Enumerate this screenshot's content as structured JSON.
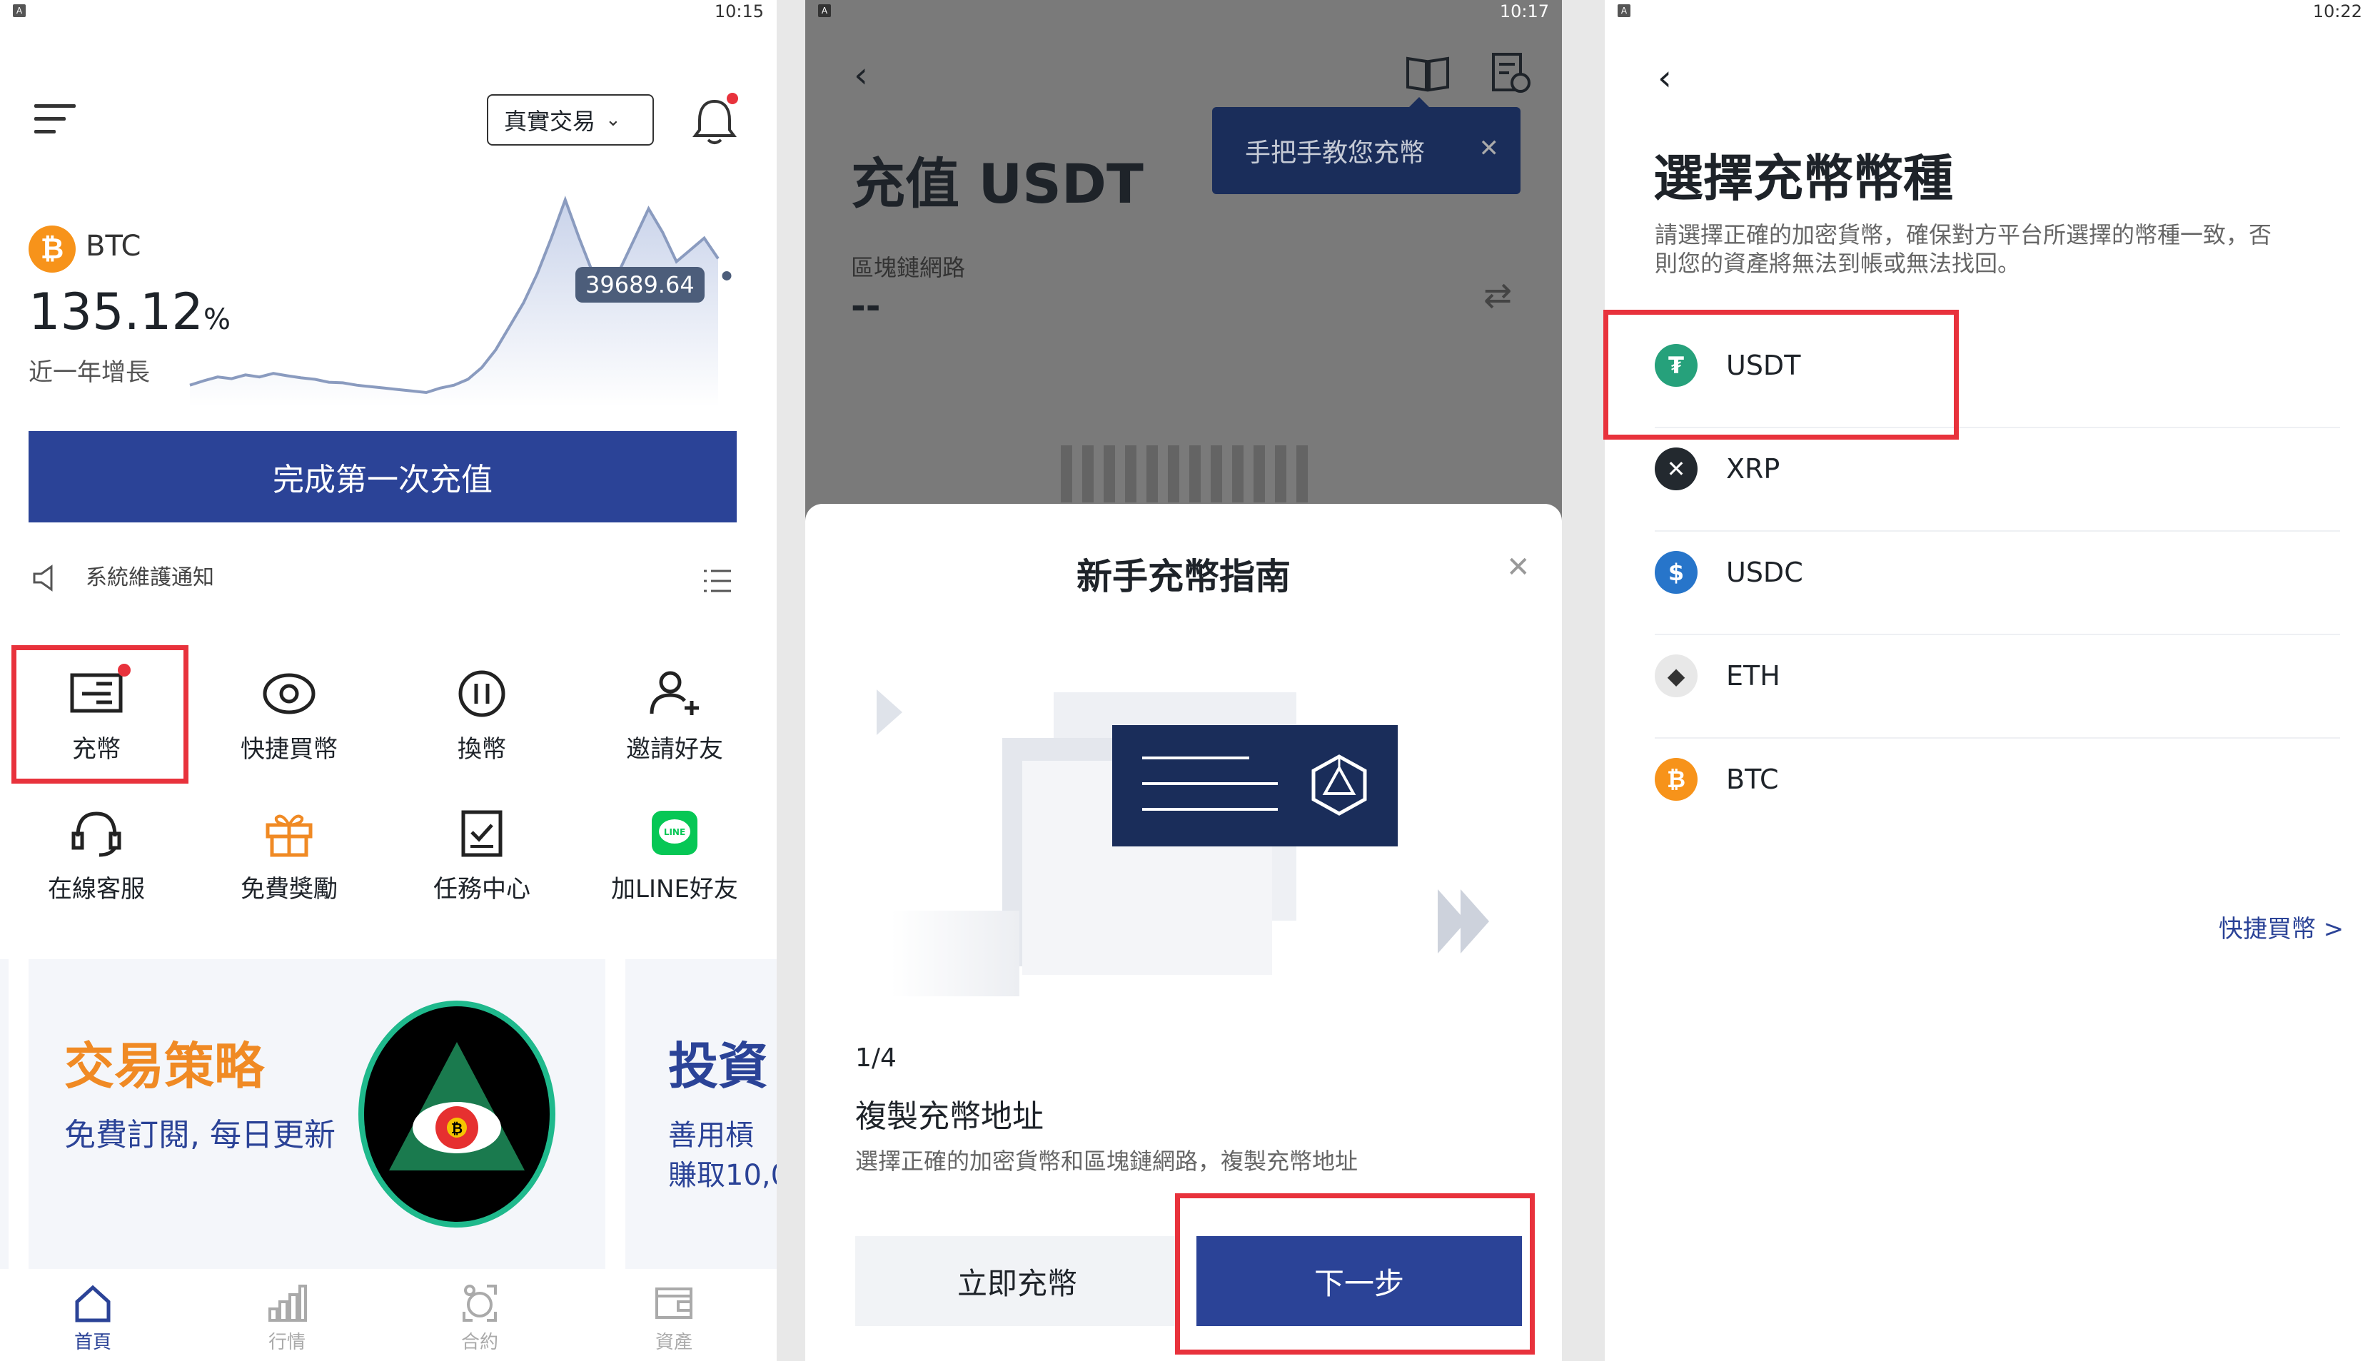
{
  "screen1": {
    "status_time": "10:15",
    "status_badge": "A",
    "mode_select": "真實交易",
    "coin_name": "BTC",
    "growth_value": "135.12",
    "growth_unit": "%",
    "growth_label": "近一年增長",
    "chart_price": "39689.64",
    "chart_data": {
      "type": "area",
      "series": [
        {
          "values": [
            520,
            535,
            548,
            542,
            555,
            548,
            560,
            552,
            545,
            540,
            530,
            528,
            520,
            515,
            510,
            505,
            500,
            495,
            510,
            520,
            540,
            580,
            640,
            720,
            800,
            900,
            1020,
            1150,
            1020,
            900,
            860,
            920,
            1020,
            1120,
            1040,
            940,
            980,
            1020,
            950
          ]
        }
      ],
      "marker_value": "39689.64"
    },
    "deposit_cta": "完成第一次充值",
    "notice_text": "系統維護通知",
    "grid_items": [
      {
        "label": "充幣",
        "icon": "deposit-icon"
      },
      {
        "label": "快捷買幣",
        "icon": "quick-buy-icon"
      },
      {
        "label": "換幣",
        "icon": "swap-icon"
      },
      {
        "label": "邀請好友",
        "icon": "invite-icon"
      },
      {
        "label": "在線客服",
        "icon": "headset-icon"
      },
      {
        "label": "免費獎勵",
        "icon": "gift-icon"
      },
      {
        "label": "任務中心",
        "icon": "task-icon"
      },
      {
        "label": "加LINE好友",
        "icon": "line-icon"
      }
    ],
    "banner1": {
      "title": "交易策略",
      "subtitle": "免費訂閱, 每日更新"
    },
    "banner2": {
      "title": "投資",
      "line1": "善用槓",
      "line2": "賺取10,0"
    },
    "bottom_nav": [
      {
        "label": "首頁",
        "icon": "home-icon",
        "active": true
      },
      {
        "label": "行情",
        "icon": "market-icon",
        "active": false
      },
      {
        "label": "合約",
        "icon": "contract-icon",
        "active": false
      },
      {
        "label": "資產",
        "icon": "wallet-icon",
        "active": false
      }
    ]
  },
  "screen2": {
    "status_time": "10:17",
    "status_badge": "A",
    "page_title": "充值 USDT",
    "tooltip": "手把手教您充幣",
    "network_label": "區塊鏈網路",
    "network_value": "--",
    "modal": {
      "title": "新手充幣指南",
      "step": "1/4",
      "step_title": "複製充幣地址",
      "step_desc": "選擇正確的加密貨幣和區塊鏈網路，複製充幣地址",
      "btn_secondary": "立即充幣",
      "btn_primary": "下一步"
    }
  },
  "screen3": {
    "status_time": "10:22",
    "status_badge": "A",
    "page_title": "選擇充幣幣種",
    "description_line1": "請選擇正確的加密貨幣，確保對方平台所選擇的幣種一致，否",
    "description_line2": "則您的資產將無法到帳或無法找回。",
    "coins": [
      {
        "symbol": "USDT",
        "color": "#26a17b",
        "glyph": "₮"
      },
      {
        "symbol": "XRP",
        "color": "#23292f",
        "glyph": "✕"
      },
      {
        "symbol": "USDC",
        "color": "#2775ca",
        "glyph": "$"
      },
      {
        "symbol": "ETH",
        "color": "#e8e8e8",
        "glyph": "◆"
      },
      {
        "symbol": "BTC",
        "color": "#f7931a",
        "glyph": "₿"
      }
    ],
    "quick_buy_link": "快捷買幣 >"
  },
  "colors": {
    "primary": "#2b4397",
    "highlight": "#e8323c",
    "navy": "#1a2d5a",
    "orange": "#f08a24"
  }
}
